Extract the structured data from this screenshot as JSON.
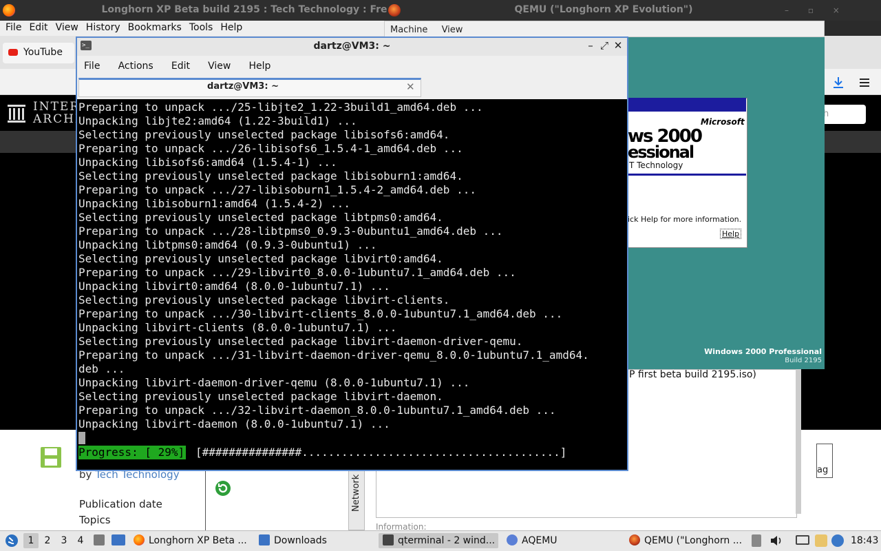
{
  "firefox": {
    "window_title": "Longhorn XP Beta build 2195 : Tech Technology : Fre",
    "menu": [
      "File",
      "Edit",
      "View",
      "History",
      "Bookmarks",
      "Tools",
      "Help"
    ],
    "tab_label": "YouTube",
    "tooltip": "YouTube",
    "search_placeholder": "h"
  },
  "archive_page": {
    "logo_line1": "INTERI",
    "logo_line2": "ARCHIV",
    "by_prefix": "by",
    "author": "Tech Technology",
    "publication_date_label": "Publication date",
    "topics_label": "Topics",
    "iso_filename": "P first beta build 2195.iso)",
    "information_label": "Information:",
    "network_tab_label": "Network",
    "flag_label": "ag"
  },
  "qemu": {
    "window_title": "QEMU (\"Longhorn XP Evolution\")",
    "menu": [
      "Machine",
      "View"
    ],
    "guest": {
      "microsoft_label": "Microsoft",
      "product_line1": "ws 2000",
      "product_line2": "essional",
      "tech_line": "T Technology",
      "help_text": "ick Help for more information.",
      "help_button": "Help",
      "brand": "Windows 2000 Professional",
      "build": "Build 2195"
    }
  },
  "terminal": {
    "window_title": "dartz@VM3: ~",
    "menu": [
      "File",
      "Actions",
      "Edit",
      "View",
      "Help"
    ],
    "tab_label": "dartz@VM3: ~",
    "lines": [
      "Preparing to unpack .../25-libjte2_1.22-3build1_amd64.deb ...",
      "Unpacking libjte2:amd64 (1.22-3build1) ...",
      "Selecting previously unselected package libisofs6:amd64.",
      "Preparing to unpack .../26-libisofs6_1.5.4-1_amd64.deb ...",
      "Unpacking libisofs6:amd64 (1.5.4-1) ...",
      "Selecting previously unselected package libisoburn1:amd64.",
      "Preparing to unpack .../27-libisoburn1_1.5.4-2_amd64.deb ...",
      "Unpacking libisoburn1:amd64 (1.5.4-2) ...",
      "Selecting previously unselected package libtpms0:amd64.",
      "Preparing to unpack .../28-libtpms0_0.9.3-0ubuntu1_amd64.deb ...",
      "Unpacking libtpms0:amd64 (0.9.3-0ubuntu1) ...",
      "Selecting previously unselected package libvirt0:amd64.",
      "Preparing to unpack .../29-libvirt0_8.0.0-1ubuntu7.1_amd64.deb ...",
      "Unpacking libvirt0:amd64 (8.0.0-1ubuntu7.1) ...",
      "Selecting previously unselected package libvirt-clients.",
      "Preparing to unpack .../30-libvirt-clients_8.0.0-1ubuntu7.1_amd64.deb ...",
      "Unpacking libvirt-clients (8.0.0-1ubuntu7.1) ...",
      "Selecting previously unselected package libvirt-daemon-driver-qemu.",
      "Preparing to unpack .../31-libvirt-daemon-driver-qemu_8.0.0-1ubuntu7.1_amd64.",
      "deb ...",
      "Unpacking libvirt-daemon-driver-qemu (8.0.0-1ubuntu7.1) ...",
      "Selecting previously unselected package libvirt-daemon.",
      "Preparing to unpack .../32-libvirt-daemon_8.0.0-1ubuntu7.1_amd64.deb ...",
      "Unpacking libvirt-daemon (8.0.0-1ubuntu7.1) ..."
    ],
    "progress_label": "Progress: [ 29%]",
    "progress_percent": 29,
    "progress_bar": "[###############.......................................]"
  },
  "taskbar": {
    "workspaces": [
      "1",
      "2",
      "3",
      "4"
    ],
    "active_workspace": "1",
    "tasks": [
      {
        "label": "Longhorn XP Beta ...",
        "icon": "firefox-icon"
      },
      {
        "label": "Downloads",
        "icon": "folder-icon"
      },
      {
        "label": "qterminal - 2 wind...",
        "icon": "terminal-icon"
      },
      {
        "label": "AQEMU",
        "icon": "aqemu-icon"
      },
      {
        "label": "QEMU (\"Longhorn ...",
        "icon": "qemu-icon"
      }
    ],
    "clock": "18:43"
  },
  "colors": {
    "terminal_bg": "#000000",
    "terminal_fg": "#e8e8e8",
    "progress_green": "#1fa81f",
    "qemu_desktop": "#3a8e8a",
    "window_accent": "#5b8bd0"
  }
}
